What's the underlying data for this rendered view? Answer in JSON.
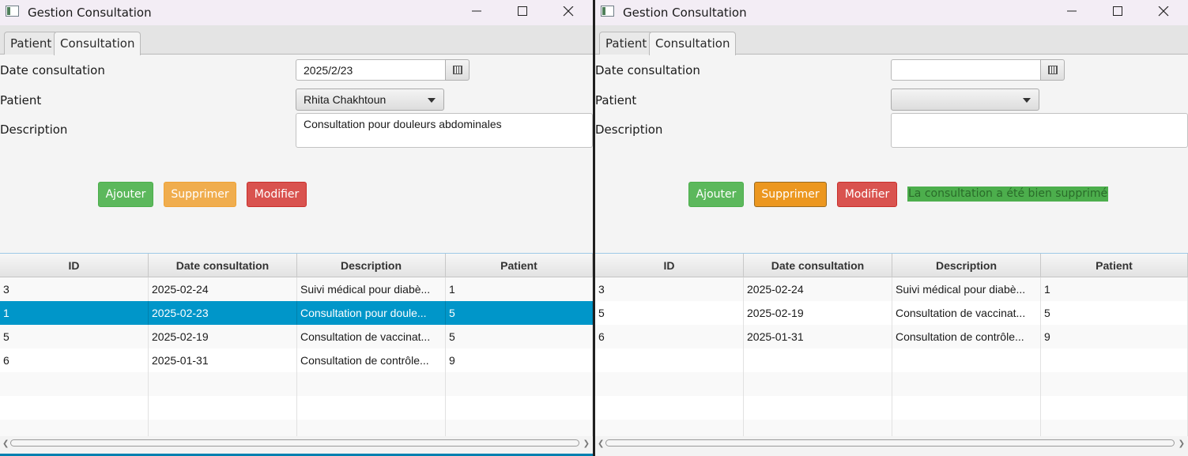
{
  "windows": [
    {
      "title": "Gestion Consultation",
      "tabs": [
        "Patient",
        "Consultation"
      ],
      "form": {
        "date_label": "Date consultation",
        "date_value": "2025/2/23",
        "patient_label": "Patient",
        "patient_value": "Rhita Chakhtoun",
        "desc_label": "Description",
        "desc_value": "Consultation pour douleurs abdominales"
      },
      "buttons": {
        "add": "Ajouter",
        "delete": "Supprimer",
        "modify": "Modifier"
      },
      "status": "",
      "table": {
        "headers": [
          "ID",
          "Date consultation",
          "Description",
          "Patient"
        ],
        "rows": [
          [
            "3",
            "2025-02-24",
            "Suivi médical pour diabè...",
            "1"
          ],
          [
            "1",
            "2025-02-23",
            "Consultation pour doule...",
            "5"
          ],
          [
            "5",
            "2025-02-19",
            "Consultation de vaccinat...",
            "5"
          ],
          [
            "6",
            "2025-01-31",
            "Consultation de contrôle...",
            "9"
          ]
        ],
        "selected_row": 1
      }
    },
    {
      "title": "Gestion Consultation",
      "tabs": [
        "Patient",
        "Consultation"
      ],
      "form": {
        "date_label": "Date consultation",
        "date_value": "",
        "patient_label": "Patient",
        "patient_value": "",
        "desc_label": "Description",
        "desc_value": ""
      },
      "buttons": {
        "add": "Ajouter",
        "delete": "Supprimer",
        "modify": "Modifier"
      },
      "status": "La consultation a été bien supprimé",
      "table": {
        "headers": [
          "ID",
          "Date consultation",
          "Description",
          "Patient"
        ],
        "rows": [
          [
            "3",
            "2025-02-24",
            "Suivi médical pour diabè...",
            "1"
          ],
          [
            "5",
            "2025-02-19",
            "Consultation de vaccinat...",
            "5"
          ],
          [
            "6",
            "2025-01-31",
            "Consultation de contrôle...",
            "9"
          ]
        ],
        "selected_row": -1
      }
    }
  ],
  "colors": {
    "add": "#5cb85c",
    "delete": "#f0ad4e",
    "modify": "#d9534f",
    "selection": "#0096c9",
    "status_bg": "#4cae4c"
  }
}
